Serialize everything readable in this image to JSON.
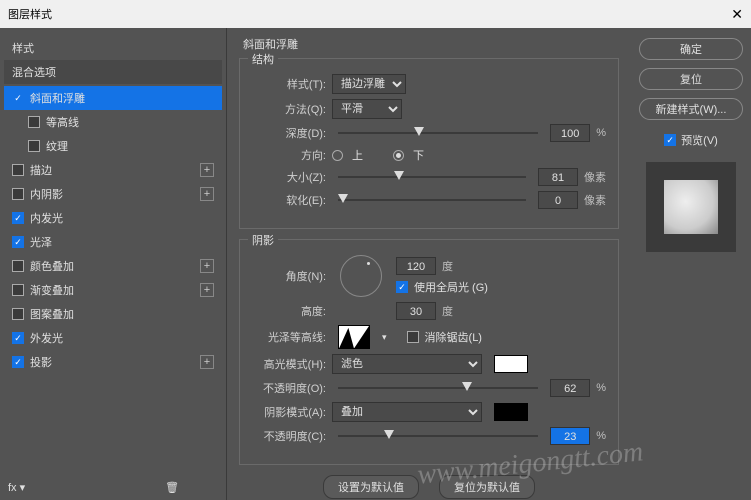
{
  "title": "图层样式",
  "left": {
    "styles_header": "样式",
    "blend_header": "混合选项",
    "items": [
      {
        "label": "斜面和浮雕",
        "on": true,
        "active": true,
        "plus": false,
        "sub": false
      },
      {
        "label": "等高线",
        "on": false,
        "active": false,
        "plus": false,
        "sub": true
      },
      {
        "label": "纹理",
        "on": false,
        "active": false,
        "plus": false,
        "sub": true
      },
      {
        "label": "描边",
        "on": false,
        "active": false,
        "plus": true,
        "sub": false
      },
      {
        "label": "内阴影",
        "on": false,
        "active": false,
        "plus": true,
        "sub": false
      },
      {
        "label": "内发光",
        "on": true,
        "active": false,
        "plus": false,
        "sub": false
      },
      {
        "label": "光泽",
        "on": true,
        "active": false,
        "plus": false,
        "sub": false
      },
      {
        "label": "颜色叠加",
        "on": false,
        "active": false,
        "plus": true,
        "sub": false
      },
      {
        "label": "渐变叠加",
        "on": false,
        "active": false,
        "plus": true,
        "sub": false
      },
      {
        "label": "图案叠加",
        "on": false,
        "active": false,
        "plus": false,
        "sub": false
      },
      {
        "label": "外发光",
        "on": true,
        "active": false,
        "plus": false,
        "sub": false
      },
      {
        "label": "投影",
        "on": true,
        "active": false,
        "plus": true,
        "sub": false
      }
    ],
    "fx": "fx"
  },
  "mid": {
    "title": "斜面和浮雕",
    "structure": {
      "legend": "结构",
      "style_lbl": "样式(T):",
      "style_val": "描边浮雕",
      "tech_lbl": "方法(Q):",
      "tech_val": "平滑",
      "depth_lbl": "深度(D):",
      "depth_val": "100",
      "depth_unit": "%",
      "dir_lbl": "方向:",
      "up": "上",
      "down": "下",
      "size_lbl": "大小(Z):",
      "size_val": "81",
      "size_unit": "像素",
      "soften_lbl": "软化(E):",
      "soften_val": "0",
      "soften_unit": "像素"
    },
    "shading": {
      "legend": "阴影",
      "angle_lbl": "角度(N):",
      "angle_val": "120",
      "deg": "度",
      "global": "使用全局光 (G)",
      "alt_lbl": "高度:",
      "alt_val": "30",
      "gloss_lbl": "光泽等高线:",
      "antialias": "消除锯齿(L)",
      "hi_mode_lbl": "高光模式(H):",
      "hi_mode_val": "滤色",
      "hi_color": "#ffffff",
      "hi_op_lbl": "不透明度(O):",
      "hi_op_val": "62",
      "pct": "%",
      "sh_mode_lbl": "阴影模式(A):",
      "sh_mode_val": "叠加",
      "sh_color": "#000000",
      "sh_op_lbl": "不透明度(C):",
      "sh_op_val": "23"
    },
    "default_set": "设置为默认值",
    "default_reset": "复位为默认值"
  },
  "right": {
    "ok": "确定",
    "cancel": "复位",
    "new_style": "新建样式(W)...",
    "preview_lbl": "预览(V)"
  },
  "watermark": "www.meigongtt.com"
}
